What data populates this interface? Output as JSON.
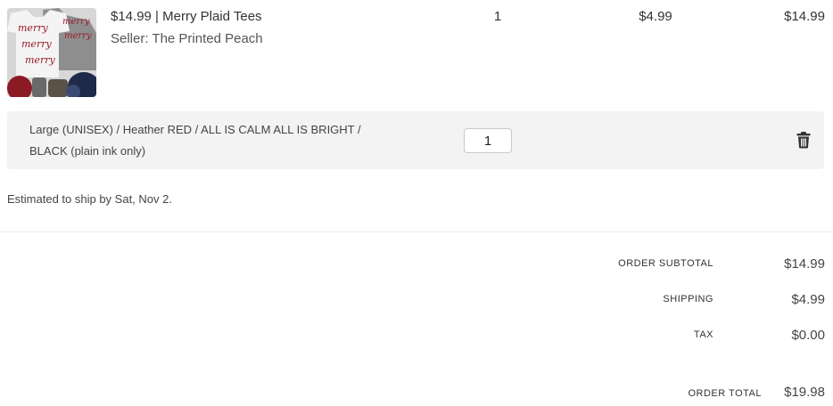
{
  "product": {
    "title": "$14.99 | Merry Plaid Tees",
    "seller": "Seller: The Printed Peach",
    "quantity": "1",
    "shipping": "$4.99",
    "total": "$14.99",
    "thumbnail_text": "merry"
  },
  "variant": {
    "line1": "Large (UNISEX) / Heather RED / ALL IS CALM ALL IS BRIGHT /",
    "line2": "BLACK (plain ink only)",
    "quantity_value": "1"
  },
  "shipping_estimate": "Estimated to ship by Sat, Nov 2.",
  "summary": {
    "subtotal_label": "ORDER SUBTOTAL",
    "subtotal_value": "$14.99",
    "shipping_label": "SHIPPING",
    "shipping_value": "$4.99",
    "tax_label": "TAX",
    "tax_value": "$0.00",
    "total_label": "ORDER TOTAL",
    "total_value": "$19.98"
  },
  "icons": {
    "delete": "trash-icon"
  },
  "colors": {
    "panel_bg": "#f3f3f3",
    "shirt_text": "#9b1b2c"
  }
}
